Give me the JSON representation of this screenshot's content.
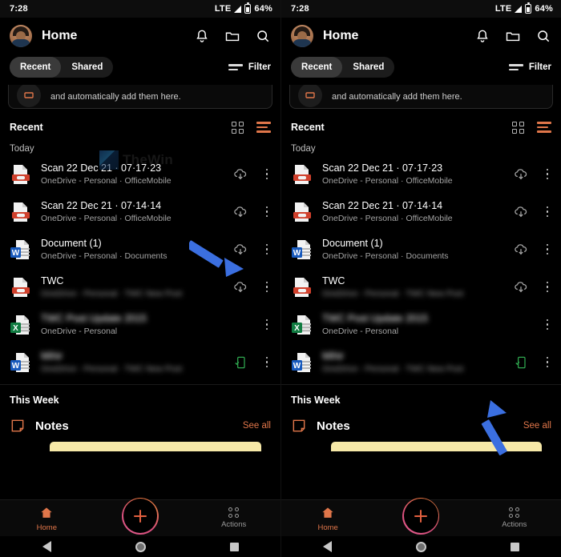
{
  "status": {
    "time": "7:28",
    "network": "LTE",
    "battery": "64%",
    "signal_icon": "signal-triangle-icon",
    "battery_icon": "battery-icon"
  },
  "appbar": {
    "title": "Home",
    "avatar_icon": "user-avatar",
    "bell_icon": "bell-icon",
    "folder_icon": "folder-icon",
    "search_icon": "search-icon"
  },
  "tabs": {
    "recent": "Recent",
    "shared": "Shared",
    "active": "Recent",
    "filter_label": "Filter",
    "filter_icon": "filter-icon"
  },
  "promo": {
    "text": "and automatically add them here.",
    "icon": "scanner-badge-icon"
  },
  "recent_header": {
    "title": "Recent",
    "grid_view_icon": "grid-view-icon",
    "list_view_icon": "list-view-icon"
  },
  "groups": {
    "today": "Today",
    "this_week": "This Week"
  },
  "files": [
    {
      "name": "Scan 22 Dec 21 · 07·17·23",
      "sub": "OneDrive - Personal · OfficeMobile",
      "icon": "pdf-file-icon",
      "action": "cloud-download-icon",
      "blurred_name": false,
      "blurred_sub": false
    },
    {
      "name": "Scan 22 Dec 21 · 07·14·14",
      "sub": "OneDrive - Personal · OfficeMobile",
      "icon": "pdf-file-icon",
      "action": "cloud-download-icon",
      "blurred_name": false,
      "blurred_sub": false
    },
    {
      "name": "Document (1)",
      "sub": "OneDrive - Personal · Documents",
      "icon": "word-file-icon",
      "action": "cloud-download-icon",
      "blurred_name": false,
      "blurred_sub": false
    },
    {
      "name": "TWC",
      "sub": "OneDrive - Personal · TWC New Post",
      "icon": "pdf-file-icon",
      "action": "cloud-download-icon",
      "blurred_name": false,
      "blurred_sub": true
    },
    {
      "name": "TWC Post Update 2015",
      "sub": "OneDrive - Personal",
      "icon": "excel-file-icon",
      "action": "none",
      "blurred_name": true,
      "blurred_sub": false
    },
    {
      "name": "Mihir",
      "sub": "OneDrive - Personal · TWC New Post",
      "icon": "word-file-icon",
      "action": "offline-available-icon",
      "blurred_name": true,
      "blurred_sub": true
    }
  ],
  "notes": {
    "title": "Notes",
    "see_all": "See all",
    "icon": "sticky-note-icon"
  },
  "bottomnav": {
    "home_label": "Home",
    "home_icon": "home-icon",
    "add_icon": "plus-icon",
    "actions_label": "Actions",
    "actions_icon": "actions-grid-icon"
  },
  "sysnav": {
    "back_icon": "android-back-icon",
    "home_icon": "android-home-icon",
    "recents_icon": "android-recents-icon"
  },
  "watermark": {
    "text": "TheWin",
    "logo_icon": "thewindowsclub-logo"
  },
  "annotations": [
    {
      "name": "arrow-left-panel",
      "target": "cloud-download-icon of Document (1)"
    },
    {
      "name": "arrow-right-panel",
      "target": "offline-available-icon of last file"
    }
  ],
  "colors": {
    "accent": "#e0764a",
    "offline_green": "#2fa84f",
    "arrow_blue": "#3b6fe0",
    "word_blue": "#185abd",
    "excel_green": "#107c41",
    "pdf_red": "#d0402c",
    "note_yellow": "#f7e9a8"
  }
}
